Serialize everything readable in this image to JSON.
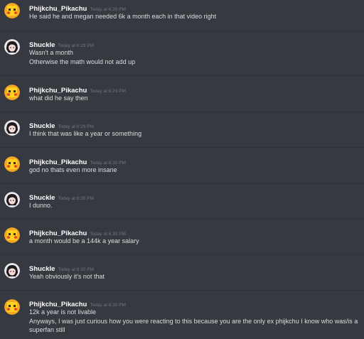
{
  "messages": [
    {
      "author": "Phijkchu_Pikachu",
      "timestamp": "Today at 6:29 PM",
      "avatar": "pikachu-avatar",
      "lines": [
        "He said he and megan needed 6k a month each in that video right"
      ]
    },
    {
      "author": "Shuckle",
      "timestamp": "Today at 6:29 PM",
      "avatar": "anime-girl-avatar",
      "lines": [
        "Wasn't a month",
        "Otherwise the math would not add up"
      ]
    },
    {
      "author": "Phijkchu_Pikachu",
      "timestamp": "Today at 6:29 PM",
      "avatar": "pikachu-avatar",
      "lines": [
        "what did he say then"
      ]
    },
    {
      "author": "Shuckle",
      "timestamp": "Today at 6:29 PM",
      "avatar": "anime-girl-avatar",
      "lines": [
        "I think that was like a year or something"
      ]
    },
    {
      "author": "Phijkchu_Pikachu",
      "timestamp": "Today at 6:30 PM",
      "avatar": "pikachu-avatar",
      "lines": [
        "god no thats even more insane"
      ]
    },
    {
      "author": "Shuckle",
      "timestamp": "Today at 6:30 PM",
      "avatar": "anime-girl-avatar",
      "lines": [
        "I dunno."
      ]
    },
    {
      "author": "Phijkchu_Pikachu",
      "timestamp": "Today at 6:30 PM",
      "avatar": "pikachu-avatar",
      "lines": [
        "a month would be a 144k a year salary"
      ]
    },
    {
      "author": "Shuckle",
      "timestamp": "Today at 6:30 PM",
      "avatar": "anime-girl-avatar",
      "lines": [
        "Yeah obviously it's not that"
      ]
    },
    {
      "author": "Phijkchu_Pikachu",
      "timestamp": "Today at 6:30 PM",
      "avatar": "pikachu-avatar",
      "lines": [
        "12k a year is not livable",
        "Anyways, I was just curious how you were reacting to this because you are the only ex phijkchu I know who was/is a superfan still"
      ]
    }
  ],
  "colors": {
    "background": "#36393f",
    "divider": "#2f3136",
    "username": "#ffffff",
    "timestamp": "#72767d",
    "message_text": "#dcddde"
  }
}
